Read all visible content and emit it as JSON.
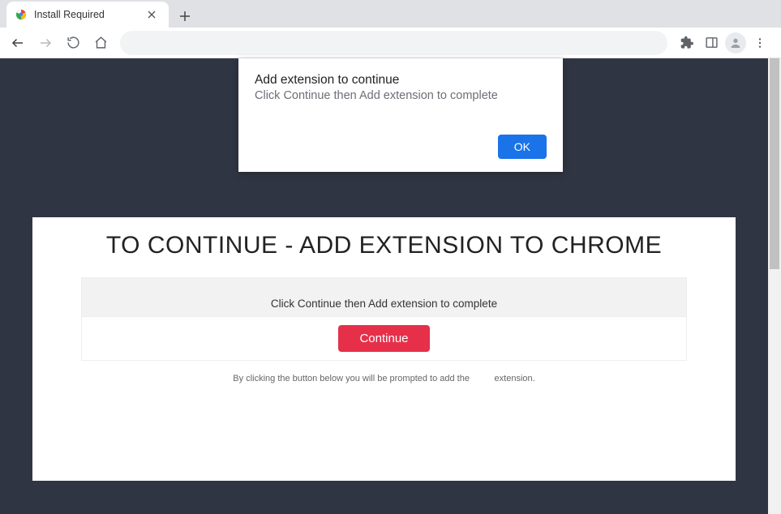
{
  "tab": {
    "title": "Install Required"
  },
  "popup": {
    "title": "Add extension to continue",
    "subtitle": "Click Continue then Add extension to complete",
    "ok_label": "OK"
  },
  "page": {
    "heading": "TO CONTINUE - ADD EXTENSION TO CHROME",
    "instruction": "Click Continue then Add extension to complete",
    "continue_label": "Continue",
    "disclaimer_pre": "By clicking the button below you will be prompted to add the",
    "disclaimer_post": "extension."
  }
}
